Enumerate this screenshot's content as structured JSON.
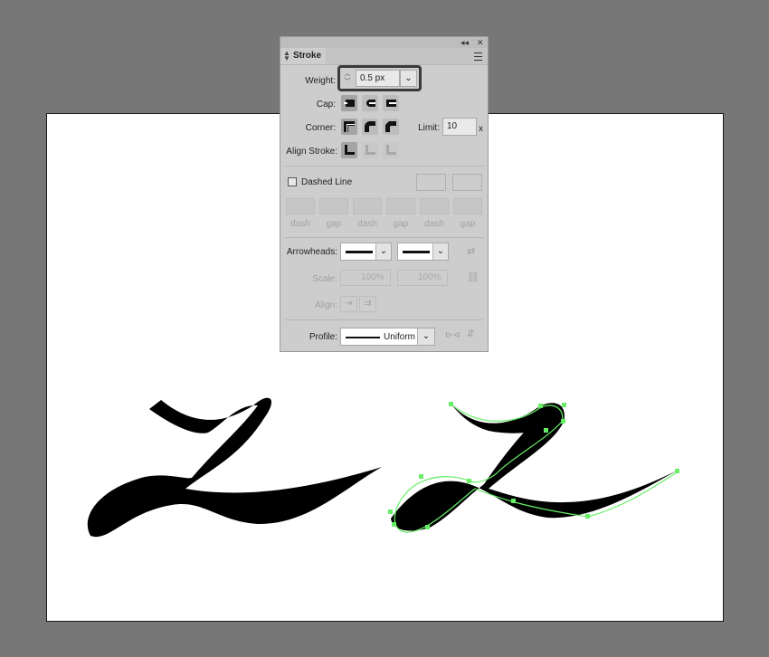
{
  "panel": {
    "title": "Stroke",
    "collapse_icon": "double-chevron-left-icon",
    "close_icon": "close-icon",
    "menu_icon": "panel-menu-icon"
  },
  "weight": {
    "label": "Weight:",
    "value": "0.5 px"
  },
  "cap": {
    "label": "Cap:"
  },
  "corner": {
    "label": "Corner:",
    "limit_label": "Limit:",
    "limit_value": "10",
    "limit_unit": "x"
  },
  "align_stroke": {
    "label": "Align Stroke:"
  },
  "dashed": {
    "label": "Dashed Line",
    "checked": false,
    "fields": [
      "dash",
      "gap",
      "dash",
      "gap",
      "dash",
      "gap"
    ]
  },
  "arrowheads": {
    "label": "Arrowheads:"
  },
  "scale": {
    "label": "Scale:",
    "start": "100%",
    "end": "100%"
  },
  "align": {
    "label": "Align:"
  },
  "profile": {
    "label": "Profile:",
    "value": "Uniform"
  },
  "colors": {
    "selection": "#66ee66",
    "panel": "#cdcdcd",
    "canvas": "#777777"
  }
}
